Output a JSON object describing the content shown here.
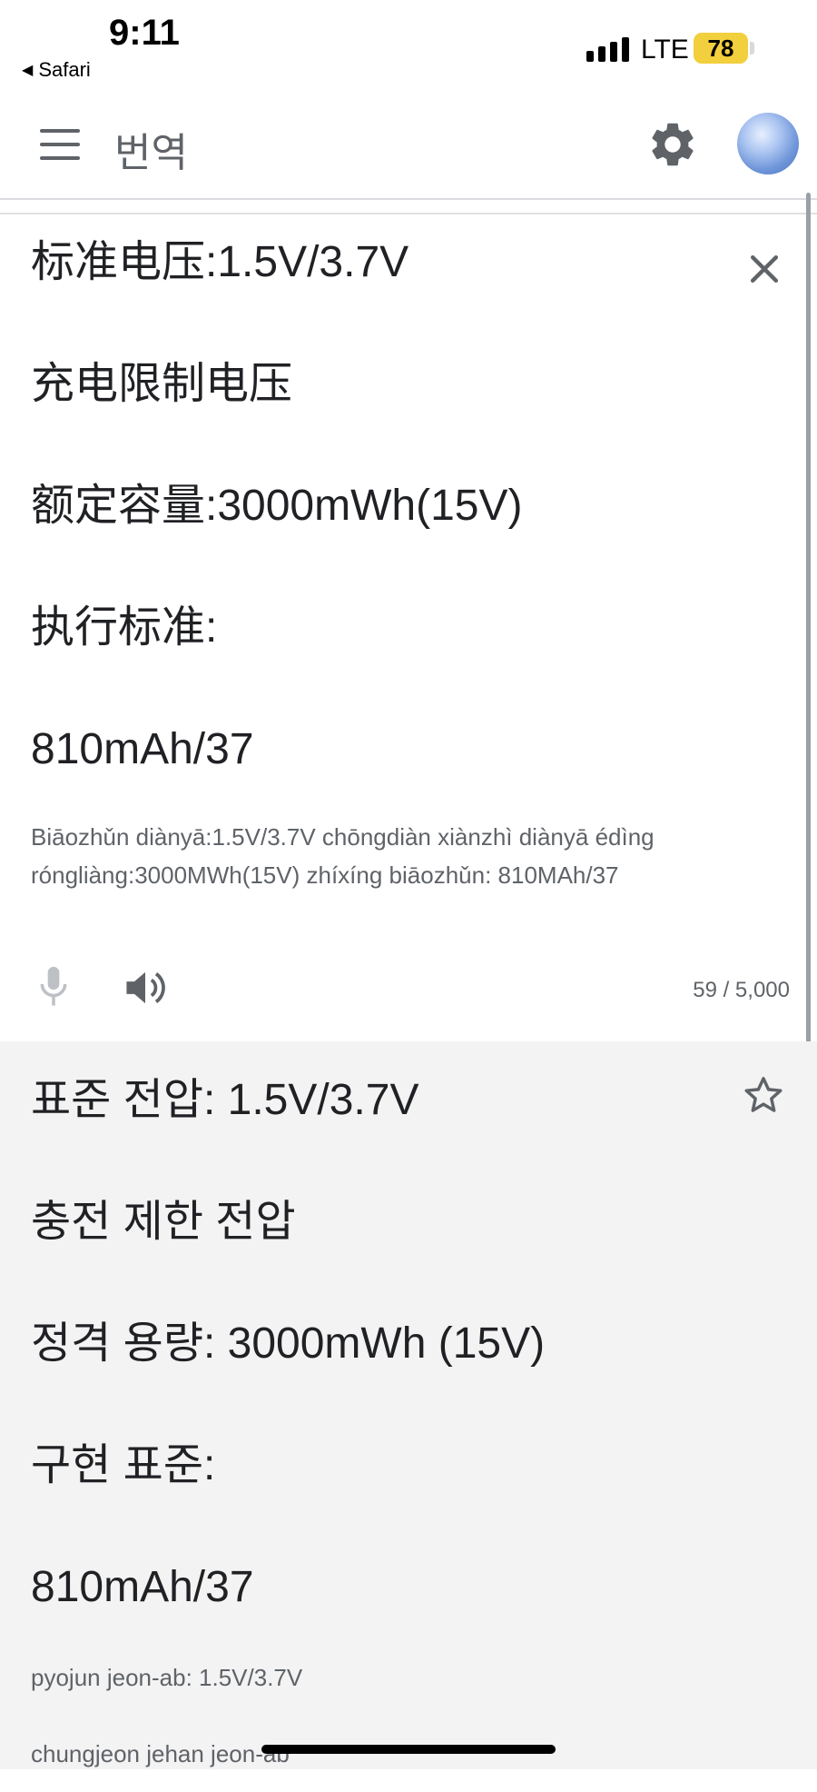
{
  "status_bar": {
    "time": "9:11",
    "back_app": "Safari",
    "network": "LTE",
    "battery": "78"
  },
  "app_bar": {
    "title": "번역"
  },
  "source": {
    "lines": [
      "标准电压:1.5V/3.7V",
      "充电限制电压",
      "额定容量:3000mWh(15V)",
      "执行标准:",
      "810mAh/37"
    ],
    "transliteration": "Biāozhǔn diànyā:1.5V/3.7V chōngdiàn xiànzhì diànyā édìng róngliàng:3000MWh(15V) zhíxíng biāozhǔn: 810MAh/37",
    "char_count": "59 / 5,000"
  },
  "target": {
    "lines": [
      "표준 전압: 1.5V/3.7V",
      "충전 제한 전압",
      "정격 용량: 3000mWh (15V)",
      "구현 표준:",
      "810mAh/37"
    ],
    "transliteration_lines": [
      "pyojun jeon-ab: 1.5V/3.7V",
      "chungjeon jehan jeon-ab"
    ]
  }
}
